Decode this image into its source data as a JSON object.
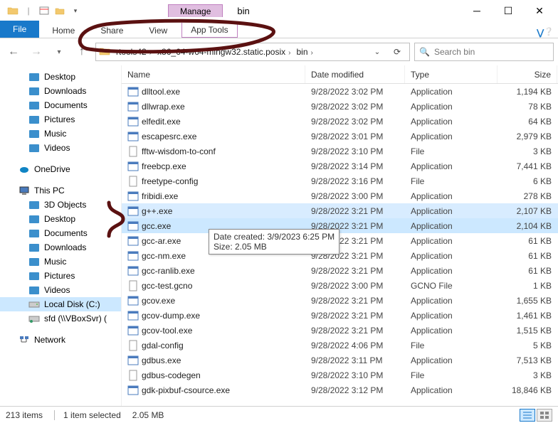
{
  "title": "bin",
  "ribbon_context": {
    "label": "Manage",
    "subtab": "App Tools"
  },
  "ribbon_tabs": [
    "File",
    "Home",
    "Share",
    "View"
  ],
  "breadcrumbs": [
    "rtools42",
    "x86_64-w64-mingw32.static.posix",
    "bin"
  ],
  "search_placeholder": "Search bin",
  "nav": {
    "quick": [
      {
        "label": "Desktop",
        "icon": "desktop"
      },
      {
        "label": "Downloads",
        "icon": "downloads"
      },
      {
        "label": "Documents",
        "icon": "documents"
      },
      {
        "label": "Pictures",
        "icon": "pictures"
      },
      {
        "label": "Music",
        "icon": "music"
      },
      {
        "label": "Videos",
        "icon": "videos"
      }
    ],
    "onedrive": {
      "label": "OneDrive"
    },
    "thispc": {
      "label": "This PC",
      "children": [
        {
          "label": "3D Objects",
          "icon": "3d"
        },
        {
          "label": "Desktop",
          "icon": "desktop"
        },
        {
          "label": "Documents",
          "icon": "documents"
        },
        {
          "label": "Downloads",
          "icon": "downloads"
        },
        {
          "label": "Music",
          "icon": "music"
        },
        {
          "label": "Pictures",
          "icon": "pictures"
        },
        {
          "label": "Videos",
          "icon": "videos"
        },
        {
          "label": "Local Disk (C:)",
          "icon": "disk",
          "selected": true
        },
        {
          "label": "sfd (\\\\VBoxSvr) (",
          "icon": "netdrive"
        }
      ]
    },
    "network": {
      "label": "Network"
    }
  },
  "columns": {
    "name": "Name",
    "date": "Date modified",
    "type": "Type",
    "size": "Size"
  },
  "files": [
    {
      "name": "dlltool.exe",
      "date": "9/28/2022 3:02 PM",
      "type": "Application",
      "size": "1,194 KB",
      "icon": "exe"
    },
    {
      "name": "dllwrap.exe",
      "date": "9/28/2022 3:02 PM",
      "type": "Application",
      "size": "78 KB",
      "icon": "exe"
    },
    {
      "name": "elfedit.exe",
      "date": "9/28/2022 3:02 PM",
      "type": "Application",
      "size": "64 KB",
      "icon": "exe"
    },
    {
      "name": "escapesrc.exe",
      "date": "9/28/2022 3:01 PM",
      "type": "Application",
      "size": "2,979 KB",
      "icon": "exe"
    },
    {
      "name": "fftw-wisdom-to-conf",
      "date": "9/28/2022 3:10 PM",
      "type": "File",
      "size": "3 KB",
      "icon": "file"
    },
    {
      "name": "freebcp.exe",
      "date": "9/28/2022 3:14 PM",
      "type": "Application",
      "size": "7,441 KB",
      "icon": "exe"
    },
    {
      "name": "freetype-config",
      "date": "9/28/2022 3:16 PM",
      "type": "File",
      "size": "6 KB",
      "icon": "file"
    },
    {
      "name": "fribidi.exe",
      "date": "9/28/2022 3:00 PM",
      "type": "Application",
      "size": "278 KB",
      "icon": "exe"
    },
    {
      "name": "g++.exe",
      "date": "9/28/2022 3:21 PM",
      "type": "Application",
      "size": "2,107 KB",
      "icon": "exe",
      "hover": true
    },
    {
      "name": "gcc.exe",
      "date": "9/28/2022 3:21 PM",
      "type": "Application",
      "size": "2,104 KB",
      "icon": "exe",
      "selected": true
    },
    {
      "name": "gcc-ar.exe",
      "date": "9/28/2022 3:21 PM",
      "type": "Application",
      "size": "61 KB",
      "icon": "exe"
    },
    {
      "name": "gcc-nm.exe",
      "date": "9/28/2022 3:21 PM",
      "type": "Application",
      "size": "61 KB",
      "icon": "exe"
    },
    {
      "name": "gcc-ranlib.exe",
      "date": "9/28/2022 3:21 PM",
      "type": "Application",
      "size": "61 KB",
      "icon": "exe"
    },
    {
      "name": "gcc-test.gcno",
      "date": "9/28/2022 3:00 PM",
      "type": "GCNO File",
      "size": "1 KB",
      "icon": "file"
    },
    {
      "name": "gcov.exe",
      "date": "9/28/2022 3:21 PM",
      "type": "Application",
      "size": "1,655 KB",
      "icon": "exe"
    },
    {
      "name": "gcov-dump.exe",
      "date": "9/28/2022 3:21 PM",
      "type": "Application",
      "size": "1,461 KB",
      "icon": "exe"
    },
    {
      "name": "gcov-tool.exe",
      "date": "9/28/2022 3:21 PM",
      "type": "Application",
      "size": "1,515 KB",
      "icon": "exe"
    },
    {
      "name": "gdal-config",
      "date": "9/28/2022 4:06 PM",
      "type": "File",
      "size": "5 KB",
      "icon": "file"
    },
    {
      "name": "gdbus.exe",
      "date": "9/28/2022 3:11 PM",
      "type": "Application",
      "size": "7,513 KB",
      "icon": "exe"
    },
    {
      "name": "gdbus-codegen",
      "date": "9/28/2022 3:10 PM",
      "type": "File",
      "size": "3 KB",
      "icon": "file"
    },
    {
      "name": "gdk-pixbuf-csource.exe",
      "date": "9/28/2022 3:12 PM",
      "type": "Application",
      "size": "18,846 KB",
      "icon": "exe"
    }
  ],
  "tooltip": {
    "line1": "Date created: 3/9/2023 6:25 PM",
    "line2": "Size: 2.05 MB"
  },
  "status": {
    "items": "213 items",
    "selected": "1 item selected",
    "size": "2.05 MB"
  }
}
